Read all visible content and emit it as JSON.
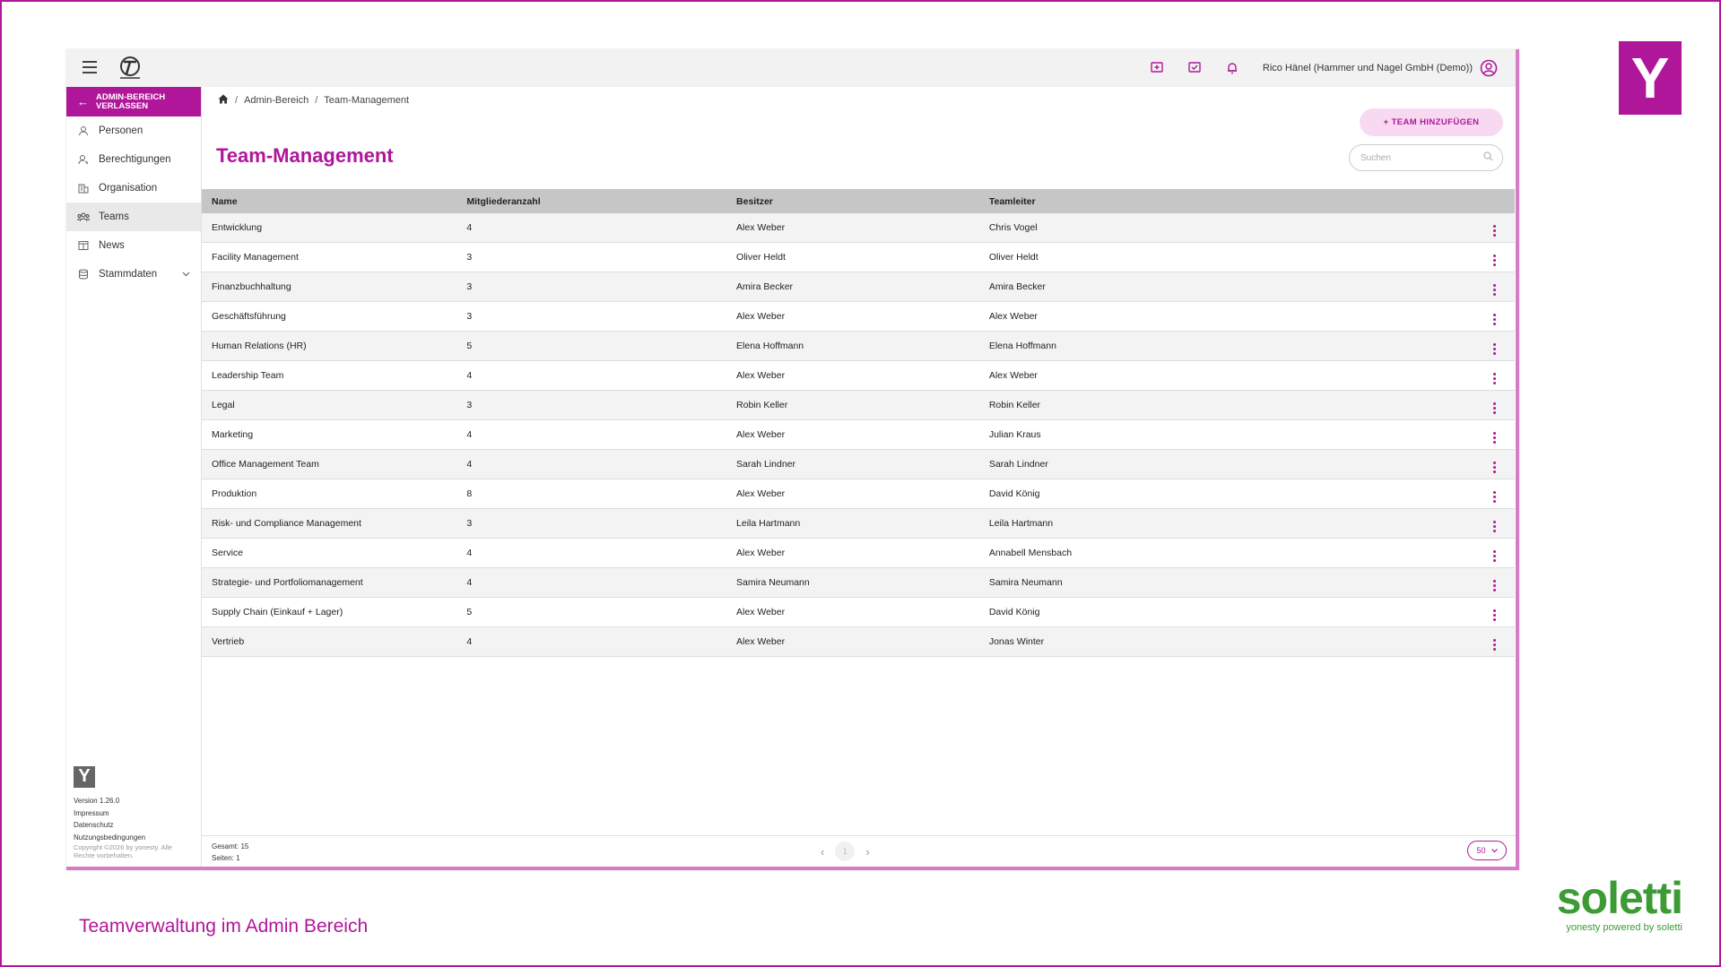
{
  "topbar": {
    "user_name": "Rico Hänel (Hammer und Nagel GmbH (Demo))",
    "icons": [
      "feedback-icon",
      "message-check-icon",
      "bell-icon",
      "user-circle-icon"
    ]
  },
  "sidebar": {
    "exit_label_1": "ADMIN-BEREICH",
    "exit_label_2": "VERLASSEN",
    "items": [
      {
        "label": "Personen",
        "icon": "person-icon"
      },
      {
        "label": "Berechtigungen",
        "icon": "key-person-icon"
      },
      {
        "label": "Organisation",
        "icon": "building-icon"
      },
      {
        "label": "Teams",
        "icon": "group-icon"
      },
      {
        "label": "News",
        "icon": "newspaper-icon"
      },
      {
        "label": "Stammdaten",
        "icon": "database-icon"
      }
    ],
    "footer": {
      "version": "Version 1.26.0",
      "impressum": "Impressum",
      "datenschutz": "Datenschutz",
      "nutzungsbedingungen": "Nutzungsbedingungen",
      "copyright_1": "Copyright ©2026 by yonesty. Alle",
      "copyright_2": "Rechte vorbehalten."
    }
  },
  "breadcrumb": {
    "item1": "Admin-Bereich",
    "item2": "Team-Management"
  },
  "page": {
    "title": "Team-Management",
    "add_button": "+ TEAM HINZUFÜGEN",
    "search_placeholder": "Suchen"
  },
  "table": {
    "headers": {
      "name": "Name",
      "members": "Mitgliederanzahl",
      "owner": "Besitzer",
      "lead": "Teamleiter"
    },
    "rows": [
      {
        "name": "Entwicklung",
        "members": "4",
        "owner": "Alex Weber",
        "lead": "Chris Vogel"
      },
      {
        "name": "Facility Management",
        "members": "3",
        "owner": "Oliver Heldt",
        "lead": "Oliver Heldt"
      },
      {
        "name": "Finanzbuchhaltung",
        "members": "3",
        "owner": "Amira Becker",
        "lead": "Amira Becker"
      },
      {
        "name": "Geschäftsführung",
        "members": "3",
        "owner": "Alex Weber",
        "lead": "Alex Weber"
      },
      {
        "name": "Human Relations (HR)",
        "members": "5",
        "owner": "Elena Hoffmann",
        "lead": "Elena Hoffmann"
      },
      {
        "name": "Leadership Team",
        "members": "4",
        "owner": "Alex Weber",
        "lead": "Alex Weber"
      },
      {
        "name": "Legal",
        "members": "3",
        "owner": "Robin Keller",
        "lead": "Robin Keller"
      },
      {
        "name": "Marketing",
        "members": "4",
        "owner": "Alex Weber",
        "lead": "Julian Kraus"
      },
      {
        "name": "Office Management Team",
        "members": "4",
        "owner": "Sarah Lindner",
        "lead": "Sarah Lindner"
      },
      {
        "name": "Produktion",
        "members": "8",
        "owner": "Alex Weber",
        "lead": "David König"
      },
      {
        "name": "Risk- und Compliance Management",
        "members": "3",
        "owner": "Leila Hartmann",
        "lead": "Leila Hartmann"
      },
      {
        "name": "Service",
        "members": "4",
        "owner": "Alex Weber",
        "lead": "Annabell Mensbach"
      },
      {
        "name": "Strategie- und Portfoliomanagement",
        "members": "4",
        "owner": "Samira Neumann",
        "lead": "Samira Neumann"
      },
      {
        "name": "Supply Chain (Einkauf + Lager)",
        "members": "5",
        "owner": "Alex Weber",
        "lead": "David König"
      },
      {
        "name": "Vertrieb",
        "members": "4",
        "owner": "Alex Weber",
        "lead": "Jonas Winter"
      }
    ]
  },
  "footer": {
    "total": "Gesamt: 15",
    "pages": "Seiten: 1",
    "current_page": "1",
    "page_size": "50"
  },
  "slide": {
    "caption": "Teamverwaltung im Admin Bereich",
    "brand_word": "soletti",
    "brand_tag": "yonesty powered by soletti",
    "brand_letter": "Y"
  },
  "colors": {
    "accent": "#b0169a",
    "brand_green": "#3c9b35"
  }
}
